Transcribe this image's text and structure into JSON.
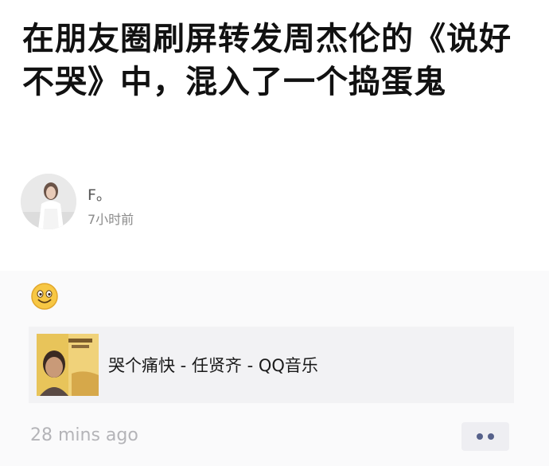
{
  "article": {
    "title": "在朋友圈刷屏转发周杰伦的《说好不哭》中，混入了一个捣蛋鬼"
  },
  "author": {
    "name": "F。",
    "time": "7小时前"
  },
  "moment": {
    "emoji_icon": "smiling-face-emoji",
    "share_link": {
      "title": "哭个痛快 - 任贤齐 - QQ音乐",
      "cover_icon": "album-cover-image"
    },
    "timestamp": "28 mins ago",
    "more_icon": "more-dots-icon"
  },
  "colors": {
    "headline": "#111111",
    "meta_text": "#8a8a8a",
    "link_bg": "#f2f2f4",
    "timestamp": "#b4b4b8",
    "more_dots": "#56618a"
  }
}
